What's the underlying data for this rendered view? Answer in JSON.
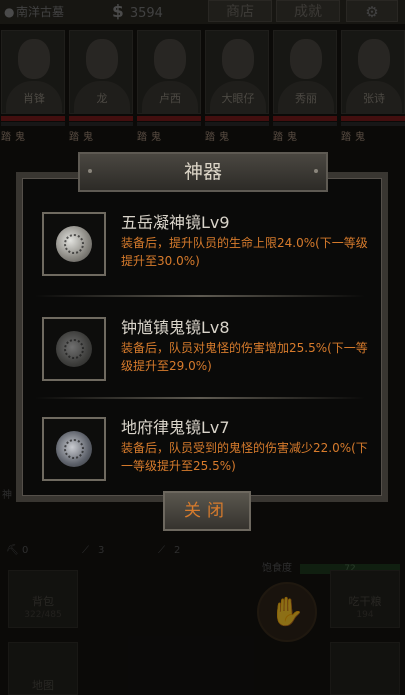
{
  "topbar": {
    "location": "南洋古墓",
    "money": "3594",
    "currency_icon": "$",
    "shop_label": "商店",
    "achievement_label": "成就",
    "settings_icon": "gear-icon"
  },
  "team": [
    {
      "name": "肖锋",
      "tags": [
        "踏",
        "鬼"
      ]
    },
    {
      "name": "龙",
      "tags": [
        "踏",
        "鬼"
      ]
    },
    {
      "name": "卢西",
      "tags": [
        "踏",
        "鬼"
      ]
    },
    {
      "name": "大眼仔",
      "tags": [
        "踏",
        "鬼"
      ]
    },
    {
      "name": "秀丽",
      "tags": [
        "踏",
        "鬼"
      ]
    },
    {
      "name": "张诗",
      "tags": [
        "踏",
        "鬼"
      ]
    }
  ],
  "status": {
    "stat1": "0",
    "stat2": "3",
    "stat3": "2",
    "guide_label": "饱食度",
    "guide_value": "72"
  },
  "actions": {
    "bag_label": "背包",
    "bag_count": "322/485",
    "food_label": "吃干粮",
    "food_count": "194",
    "map_label": "地图"
  },
  "side_text": "神",
  "modal": {
    "title": "神器",
    "items": [
      {
        "name": "五岳凝神镜Lv9",
        "desc": "装备后，提升队员的生命上限24.0%(下一等级提升至30.0%)"
      },
      {
        "name": "钟馗镇鬼镜Lv8",
        "desc": "装备后，队员对鬼怪的伤害增加25.5%(下一等级提升至29.0%)"
      },
      {
        "name": "地府律鬼镜Lv7",
        "desc": "装备后，队员受到的鬼怪的伤害减少22.0%(下一等级提升至25.5%)"
      }
    ],
    "close_label": "关闭"
  },
  "colors": {
    "desc_orange": "#d77b2c",
    "hp_red": "#7a1c1c"
  }
}
